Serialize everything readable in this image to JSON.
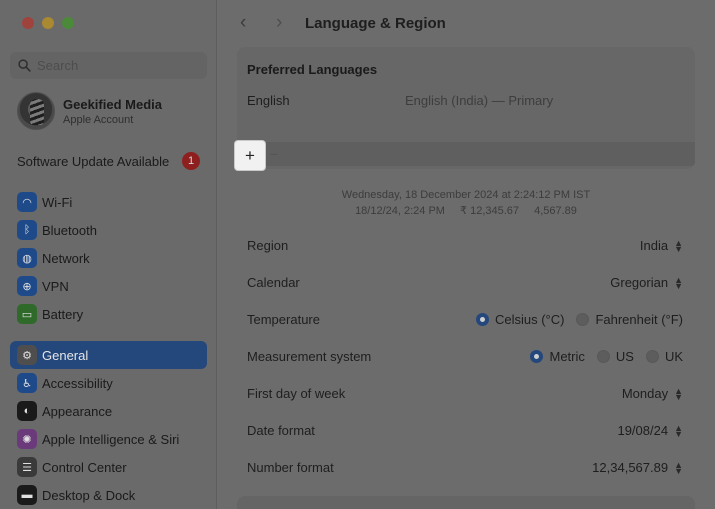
{
  "window": {
    "title": "Language & Region",
    "colors": {
      "accent": "#24477c",
      "badge": "#8e1f1f"
    }
  },
  "sidebar": {
    "search_placeholder": "Search",
    "account": {
      "name": "Geekified Media",
      "subtitle": "Apple Account"
    },
    "update": {
      "label": "Software Update Available",
      "count": "1"
    },
    "group1": [
      {
        "label": "Wi-Fi",
        "icon": "wifi-icon",
        "color": "#1f4a8a",
        "glyph": "◠"
      },
      {
        "label": "Bluetooth",
        "icon": "bluetooth-icon",
        "color": "#1f4a8a",
        "glyph": "ᛒ"
      },
      {
        "label": "Network",
        "icon": "globe-icon",
        "color": "#1f4a8a",
        "glyph": "◍"
      },
      {
        "label": "VPN",
        "icon": "vpn-icon",
        "color": "#1f4a8a",
        "glyph": "⊕"
      },
      {
        "label": "Battery",
        "icon": "battery-icon",
        "color": "#2f6a2a",
        "glyph": "▭"
      }
    ],
    "group2": [
      {
        "label": "General",
        "icon": "gear-icon",
        "color": "#4e4e4e",
        "glyph": "⚙",
        "selected": true
      },
      {
        "label": "Accessibility",
        "icon": "accessibility-icon",
        "color": "#1f4a8a",
        "glyph": "♿"
      },
      {
        "label": "Appearance",
        "icon": "appearance-icon",
        "color": "#1a1a1a",
        "glyph": "◐"
      },
      {
        "label": "Apple Intelligence & Siri",
        "icon": "siri-icon",
        "color": "#6a3a7a",
        "glyph": "✺"
      },
      {
        "label": "Control Center",
        "icon": "control-center-icon",
        "color": "#3a3a3a",
        "glyph": "☰"
      },
      {
        "label": "Desktop & Dock",
        "icon": "dock-icon",
        "color": "#1a1a1a",
        "glyph": "▬"
      }
    ]
  },
  "main": {
    "title": "Language & Region",
    "preferred": {
      "title": "Preferred Languages",
      "language": "English",
      "detail": "English (India) — Primary",
      "add": "+",
      "remove": "−"
    },
    "preview": {
      "line1": "Wednesday, 18 December 2024 at 2:24:12 PM IST",
      "date": "18/12/24, 2:24 PM",
      "currency": "₹ 12,345.67",
      "number": "4,567.89"
    },
    "rows": {
      "region": {
        "label": "Region",
        "value": "India"
      },
      "calendar": {
        "label": "Calendar",
        "value": "Gregorian"
      },
      "temperature": {
        "label": "Temperature",
        "opt1": "Celsius (°C)",
        "opt2": "Fahrenheit (°F)"
      },
      "measurement": {
        "label": "Measurement system",
        "opt1": "Metric",
        "opt2": "US",
        "opt3": "UK"
      },
      "first_day": {
        "label": "First day of week",
        "value": "Monday"
      },
      "date_format": {
        "label": "Date format",
        "value": "19/08/24"
      },
      "number_format": {
        "label": "Number format",
        "value": "12,34,567.89"
      }
    }
  }
}
